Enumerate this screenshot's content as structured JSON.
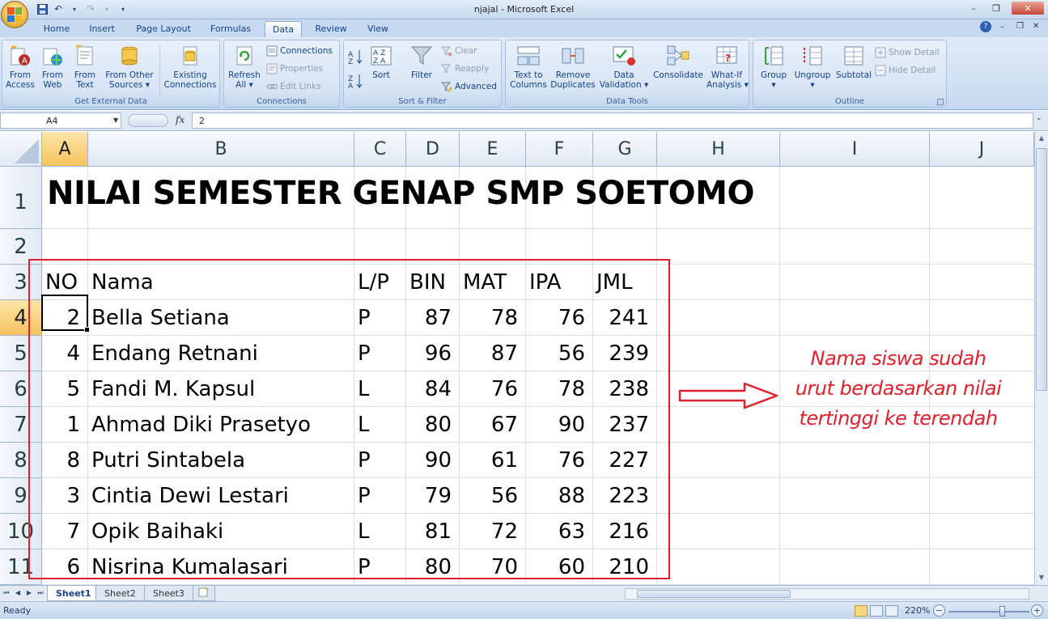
{
  "window": {
    "title": "njajal - Microsoft Excel",
    "minimize": "–",
    "restore": "❐",
    "close": "✕"
  },
  "tabs": [
    {
      "label": "Home"
    },
    {
      "label": "Insert"
    },
    {
      "label": "Page Layout"
    },
    {
      "label": "Formulas"
    },
    {
      "label": "Data",
      "active": true
    },
    {
      "label": "Review"
    },
    {
      "label": "View"
    }
  ],
  "ribbon": {
    "get_external_data": {
      "label": "Get External Data",
      "from_access": "From\nAccess",
      "from_web": "From\nWeb",
      "from_text": "From\nText",
      "from_other": "From Other\nSources ▾",
      "existing": "Existing\nConnections"
    },
    "connections": {
      "label": "Connections",
      "refresh": "Refresh\nAll ▾",
      "connections": "Connections",
      "properties": "Properties",
      "edit_links": "Edit Links"
    },
    "sort_filter": {
      "label": "Sort & Filter",
      "sort": "Sort",
      "filter": "Filter",
      "clear": "Clear",
      "reapply": "Reapply",
      "advanced": "Advanced"
    },
    "data_tools": {
      "label": "Data Tools",
      "text_to_columns": "Text to\nColumns",
      "remove_duplicates": "Remove\nDuplicates",
      "data_validation": "Data\nValidation ▾",
      "consolidate": "Consolidate",
      "what_if": "What-If\nAnalysis ▾"
    },
    "outline": {
      "label": "Outline",
      "group": "Group\n▾",
      "ungroup": "Ungroup\n▾",
      "subtotal": "Subtotal",
      "show_detail": "Show Detail",
      "hide_detail": "Hide Detail"
    }
  },
  "formula_bar": {
    "name_box": "A4",
    "fx": "fx",
    "value": "2"
  },
  "columns": [
    {
      "label": "A",
      "selected": true
    },
    {
      "label": "B"
    },
    {
      "label": "C"
    },
    {
      "label": "D"
    },
    {
      "label": "E"
    },
    {
      "label": "F"
    },
    {
      "label": "G"
    },
    {
      "label": "H"
    },
    {
      "label": "I"
    },
    {
      "label": "J"
    }
  ],
  "rows": [
    {
      "label": "1"
    },
    {
      "label": "2"
    },
    {
      "label": "3"
    },
    {
      "label": "4",
      "selected": true
    },
    {
      "label": "5"
    },
    {
      "label": "6"
    },
    {
      "label": "7"
    },
    {
      "label": "8"
    },
    {
      "label": "9"
    },
    {
      "label": "10"
    },
    {
      "label": "11"
    }
  ],
  "sheet": {
    "title": "NILAI SEMESTER GENAP SMP SOETOMO",
    "headers": [
      "NO",
      "Nama",
      "L/P",
      "BIN",
      "MAT",
      "IPA",
      "JML"
    ],
    "records": [
      [
        "2",
        "Bella Setiana",
        "P",
        "87",
        "78",
        "76",
        "241"
      ],
      [
        "4",
        "Endang Retnani",
        "P",
        "96",
        "87",
        "56",
        "239"
      ],
      [
        "5",
        "Fandi M. Kapsul",
        "L",
        "84",
        "76",
        "78",
        "238"
      ],
      [
        "1",
        "Ahmad Diki Prasetyo",
        "L",
        "80",
        "67",
        "90",
        "237"
      ],
      [
        "8",
        "Putri Sintabela",
        "P",
        "90",
        "61",
        "76",
        "227"
      ],
      [
        "3",
        "Cintia Dewi Lestari",
        "P",
        "79",
        "56",
        "88",
        "223"
      ],
      [
        "7",
        "Opik Baihaki",
        "L",
        "81",
        "72",
        "63",
        "216"
      ],
      [
        "6",
        "Nisrina Kumalasari",
        "P",
        "80",
        "70",
        "60",
        "210"
      ]
    ]
  },
  "annotation": {
    "line1": "Nama siswa sudah",
    "line2": "urut berdasarkan nilai",
    "line3": "tertinggi ke terendah"
  },
  "sheet_tabs": [
    {
      "label": "Sheet1",
      "active": true
    },
    {
      "label": "Sheet2"
    },
    {
      "label": "Sheet3"
    }
  ],
  "status": {
    "text": "Ready",
    "zoom": "220%"
  },
  "colors": {
    "annotation_red": "#e0202e",
    "selection_header": "#f5c35e",
    "ribbon_blue": "#d1e0f3"
  }
}
